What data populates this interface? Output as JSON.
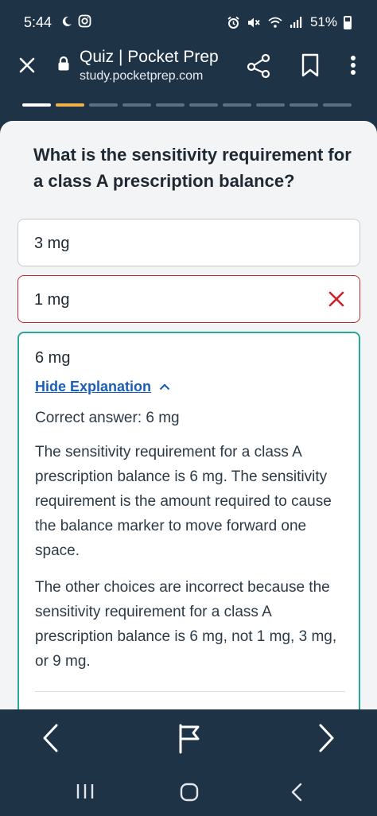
{
  "status_bar": {
    "time": "5:44",
    "battery": "51%",
    "icons": [
      "moon-icon",
      "instagram-icon",
      "alarm-icon",
      "mute-icon",
      "wifi-icon",
      "signal-icon",
      "battery-icon"
    ]
  },
  "browser": {
    "title": "Quiz | Pocket Prep",
    "url": "study.pocketprep.com",
    "icons": [
      "close-icon",
      "lock-icon",
      "share-icon",
      "bookmark-icon",
      "more-vertical-icon"
    ]
  },
  "progress": {
    "total_segments": 10,
    "current_index": 1
  },
  "question": {
    "text": "What is the sensitivity requirement for a class A prescription balance?"
  },
  "options": [
    {
      "label": "3 mg",
      "state": "neutral"
    },
    {
      "label": "1 mg",
      "state": "incorrect-selected"
    },
    {
      "label": "6 mg",
      "state": "correct"
    }
  ],
  "explanation": {
    "toggle_label": "Hide Explanation",
    "correct_answer": "Correct answer: 6 mg",
    "paragraph1": "The sensitivity requirement for a class A prescription balance is 6 mg. The sensitivity requirement is the amount required to cause the balance marker to move forward one space.",
    "paragraph2": "The other choices are incorrect because the sensitivity requirement for a class A prescription balance is 6 mg, not 1 mg, 3 mg, or 9 mg."
  },
  "colors": {
    "header_bg": "#1f3347",
    "card_bg": "#f3f4f6",
    "correct_border": "#2aa79b",
    "incorrect_border": "#c8262c",
    "progress_active": "#f0b54a",
    "progress_done": "#ffffff",
    "link": "#1a5fb4"
  },
  "bottom_nav": {
    "icons": [
      "chevron-left-icon",
      "flag-icon",
      "chevron-right-icon"
    ]
  },
  "system_nav": {
    "icons": [
      "recent-apps-icon",
      "home-icon",
      "back-icon"
    ]
  }
}
